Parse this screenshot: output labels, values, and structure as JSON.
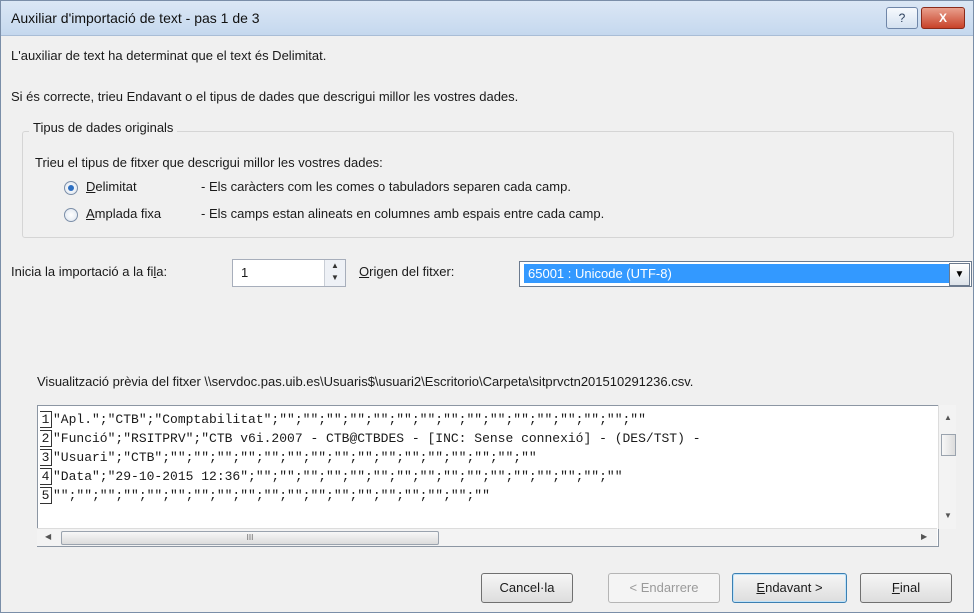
{
  "window": {
    "title": "Auxiliar d'importació de text - pas 1 de 3",
    "help_label": "?",
    "close_label": "X"
  },
  "intro": {
    "line1": "L'auxiliar de text ha determinat que el text és Delimitat.",
    "line2": "Si és correcte, trieu Endavant o el tipus de dades que descrigui millor les vostres dades."
  },
  "group": {
    "legend": "Tipus de dades originals",
    "prompt": "Trieu el tipus de fitxer que descrigui millor les vostres dades:",
    "options": [
      {
        "label_key": "D",
        "label_rest": "elimitat",
        "desc": "- Els caràcters com les comes o tabuladors separen cada camp.",
        "selected": true
      },
      {
        "label_key": "A",
        "label_rest": "mplada fixa",
        "desc": "- Els camps estan alineats en columnes amb espais entre cada camp.",
        "selected": false
      }
    ]
  },
  "start_row": {
    "label_pre": "Inicia la importació a la fi",
    "label_key": "l",
    "label_post": "a:",
    "value": "1"
  },
  "origin": {
    "label_key": "O",
    "label_rest": "rigen del fitxer:",
    "value": "65001 : Unicode (UTF-8)"
  },
  "preview": {
    "label": "Visualització prèvia del fitxer \\\\servdoc.pas.uib.es\\Usuaris$\\usuari2\\Escritorio\\Carpeta\\sitprvctn201510291236.csv.",
    "lines": [
      {
        "num": "1",
        "text": "\"Apl.\";\"CTB\";\"Comptabilitat\";\"\";\"\";\"\";\"\";\"\";\"\";\"\";\"\";\"\";\"\";\"\";\"\";\"\";\"\";\"\";\"\""
      },
      {
        "num": "2",
        "text": "\"Funció\";\"RSITPRV\";\"CTB v6i.2007 - CTB@CTBDES - [INC: Sense connexió] - (DES/TST) -"
      },
      {
        "num": "3",
        "text": "\"Usuari\";\"CTB\";\"\";\"\";\"\";\"\";\"\";\"\";\"\";\"\";\"\";\"\";\"\";\"\";\"\";\"\";\"\";\"\""
      },
      {
        "num": "4",
        "text": "\"Data\";\"29-10-2015 12:36\";\"\";\"\";\"\";\"\";\"\";\"\";\"\";\"\";\"\";\"\";\"\";\"\";\"\";\"\";\"\";\"\""
      },
      {
        "num": "5",
        "text": "\"\";\"\";\"\";\"\";\"\";\"\";\"\";\"\";\"\";\"\";\"\";\"\";\"\";\"\";\"\";\"\";\"\";\"\";\"\""
      }
    ]
  },
  "buttons": {
    "cancel": "Cancel·la",
    "back": "< Endarrere",
    "next_key": "E",
    "next_rest": "ndavant >",
    "finish_key": "F",
    "finish_rest": "inal"
  }
}
